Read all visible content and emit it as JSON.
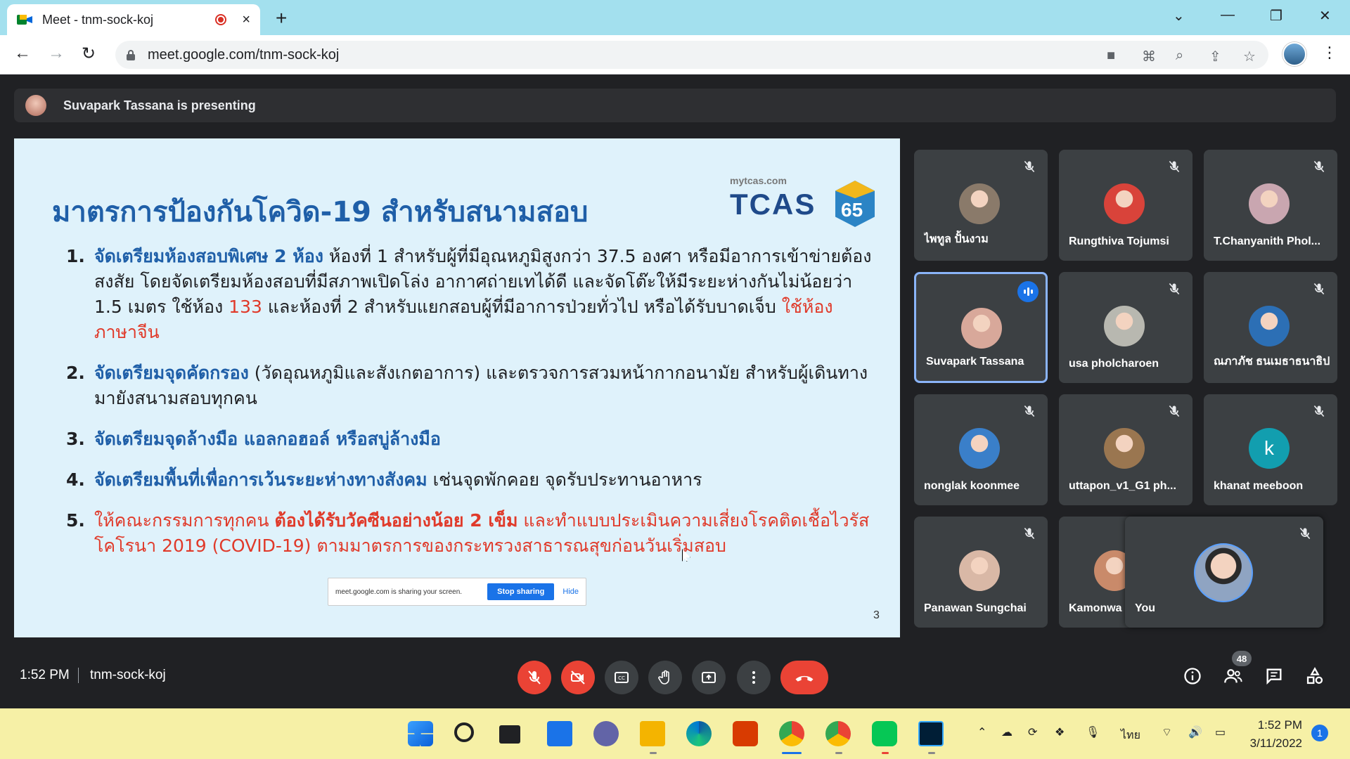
{
  "browser": {
    "tab_title": "Meet - tnm-sock-koj",
    "url": "meet.google.com/tnm-sock-koj",
    "new_tab": "+",
    "tab_close": "×"
  },
  "meet": {
    "presenting_text": "Suvapark Tassana is presenting",
    "time": "1:52 PM",
    "meeting_code": "tnm-sock-koj",
    "people_count": "48"
  },
  "slide": {
    "title": "มาตรการป้องกันโควิด-19 สำหรับสนามสอบ",
    "logo_small": "mytcas.com",
    "logo_word": "TCAS",
    "logo_num": "65",
    "page_number": "3",
    "points": [
      {
        "num": "1.",
        "lead": "จัดเตรียมห้องสอบพิเศษ 2 ห้อง",
        "text_a": " ห้องที่ 1 สำหรับผู้ที่มีอุณหภูมิสูงกว่า 37.5 องศา หรือมีอาการเข้าข่ายต้องสงสัย โดยจัดเตรียมห้องสอบที่มีสภาพเปิดโล่ง อากาศถ่ายเทได้ดี และจัดโต๊ะให้มีระยะห่างกันไม่น้อยว่า 1.5 เมตร ใช้ห้อง ",
        "room": "133",
        "text_b": "  และห้องที่ 2 สำหรับแยกสอบผู้ที่มีอาการป่วยทั่วไป หรือได้รับบาดเจ็บ ",
        "room2": "ใช้ห้องภาษาจีน"
      },
      {
        "num": "2.",
        "lead": "จัดเตรียมจุดคัดกรอง",
        "text": " (วัดอุณหภูมิและสังเกตอาการ) และตรวจการสวมหน้ากากอนามัย  สำหรับผู้เดินทางมายังสนามสอบทุกคน"
      },
      {
        "num": "3.",
        "lead": "จัดเตรียมจุดล้างมือ แอลกอฮอล์ หรือสบู่ล้างมือ"
      },
      {
        "num": "4.",
        "lead": "จัดเตรียมพื้นที่เพื่อการเว้นระยะห่างทางสังคม",
        "text": " เช่นจุดพักคอย จุดรับประทานอาหาร"
      },
      {
        "num": "5.",
        "text_a": "ให้คณะกรรมการทุกคน ",
        "bold": "ต้องได้รับวัคซีนอย่างน้อย 2 เข็ม",
        "text_b": " และทำแบบประเมินความเสี่ยงโรคติดเชื้อไวรัสโคโรนา 2019 (COVID-19) ตามมาตรการของกระทรวงสาธารณสุขก่อนวันเริ่มสอบ"
      }
    ]
  },
  "share_notice": {
    "text": "meet.google.com is sharing your screen.",
    "stop": "Stop sharing",
    "hide": "Hide"
  },
  "participants": [
    {
      "name": "ไพทูล ปั้นงาม",
      "color": "#8a7a6a"
    },
    {
      "name": "Rungthiva Tojumsi",
      "color": "#d9433a"
    },
    {
      "name": "T.Chanyanith Phol...",
      "color": "#c9a6b0"
    },
    {
      "name": "Suvapark Tassana",
      "color": "#d8a89a"
    },
    {
      "name": "usa pholcharoen",
      "color": "#b8b8b0"
    },
    {
      "name": "ณภาภัช ธนเมธาธนาธิป",
      "color": "#2c6fb5"
    },
    {
      "name": "nonglak koonmee",
      "color": "#3a7fc9"
    },
    {
      "name": "uttapon_v1_G1 ph...",
      "color": "#9a7650"
    },
    {
      "name": "khanat meeboon",
      "letter": "k"
    },
    {
      "name": "Panawan Sungchai",
      "color": "#d9b8a6"
    },
    {
      "name": "Kamonwa",
      "color": "#c98a6a"
    }
  ],
  "self": {
    "name": "You"
  },
  "taskbar": {
    "lang": "ไทย",
    "time": "1:52 PM",
    "date": "3/11/2022",
    "notifications": "1"
  }
}
